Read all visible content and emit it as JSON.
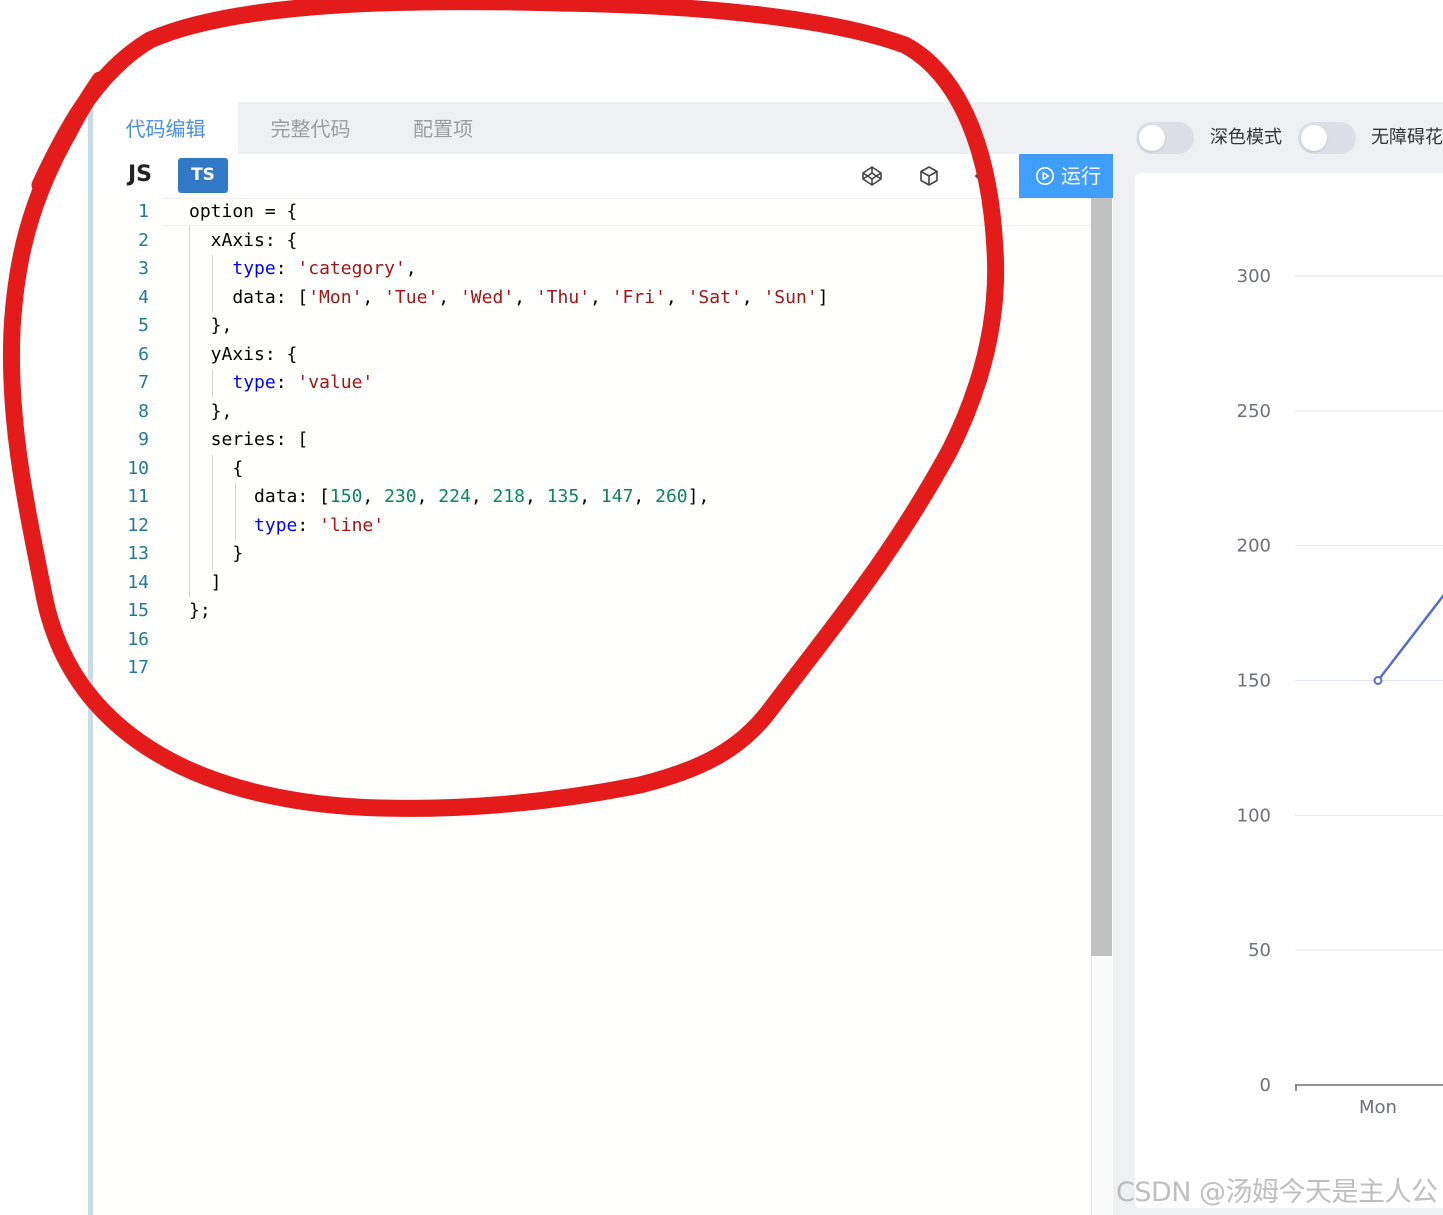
{
  "tabs": {
    "code_edit": "代码编辑",
    "full_code": "完整代码",
    "config": "配置项"
  },
  "toolbar": {
    "js_label": "JS",
    "ts_label": "TS",
    "run_label": "运行"
  },
  "code": {
    "line_numbers": [
      "1",
      "2",
      "3",
      "4",
      "5",
      "6",
      "7",
      "8",
      "9",
      "10",
      "11",
      "12",
      "13",
      "14",
      "15",
      "16",
      "17"
    ]
  },
  "preview": {
    "dark_mode_label": "深色模式",
    "accessibility_label": "无障碍花",
    "dark_mode_on": false,
    "accessibility_on": false
  },
  "chart_data": {
    "type": "line",
    "categories": [
      "Mon",
      "Tue",
      "Wed",
      "Thu",
      "Fri",
      "Sat",
      "Sun"
    ],
    "series": [
      {
        "values": [
          150,
          230,
          224,
          218,
          135,
          147,
          260
        ]
      }
    ],
    "visible_categories": [
      "Mon"
    ],
    "yticks": [
      "300",
      "250",
      "200",
      "150",
      "100",
      "50",
      "0"
    ],
    "ylim": [
      0,
      300
    ],
    "grid": true,
    "line_color": "#5470c6"
  },
  "watermark": "CSDN @汤姆今天是主人公",
  "annotation": {
    "color": "#e41b1b"
  }
}
